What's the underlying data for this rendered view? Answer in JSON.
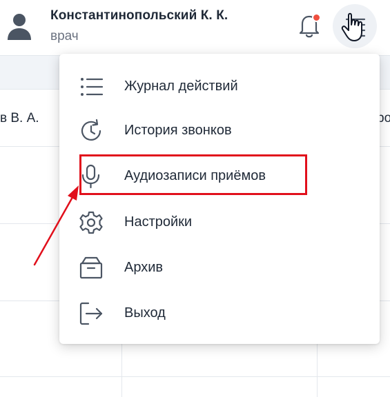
{
  "header": {
    "user_name": "Константинопольский К. К.",
    "user_role": "врач",
    "notification_badge_color": "#ef4f3f"
  },
  "background_table": {
    "visible_cell_left": "в В. А.",
    "visible_cell_right": "ро"
  },
  "menu": {
    "items": [
      {
        "label": "Журнал действий",
        "icon": "list-icon"
      },
      {
        "label": "История звонков",
        "icon": "history-icon"
      },
      {
        "label": "Аудиозаписи приёмов",
        "icon": "microphone-icon",
        "highlighted": true
      },
      {
        "label": "Настройки",
        "icon": "gear-icon"
      },
      {
        "label": "Архив",
        "icon": "archive-box-icon"
      },
      {
        "label": "Выход",
        "icon": "logout-icon"
      }
    ]
  },
  "annotation": {
    "highlight_color": "#e10f1b"
  }
}
